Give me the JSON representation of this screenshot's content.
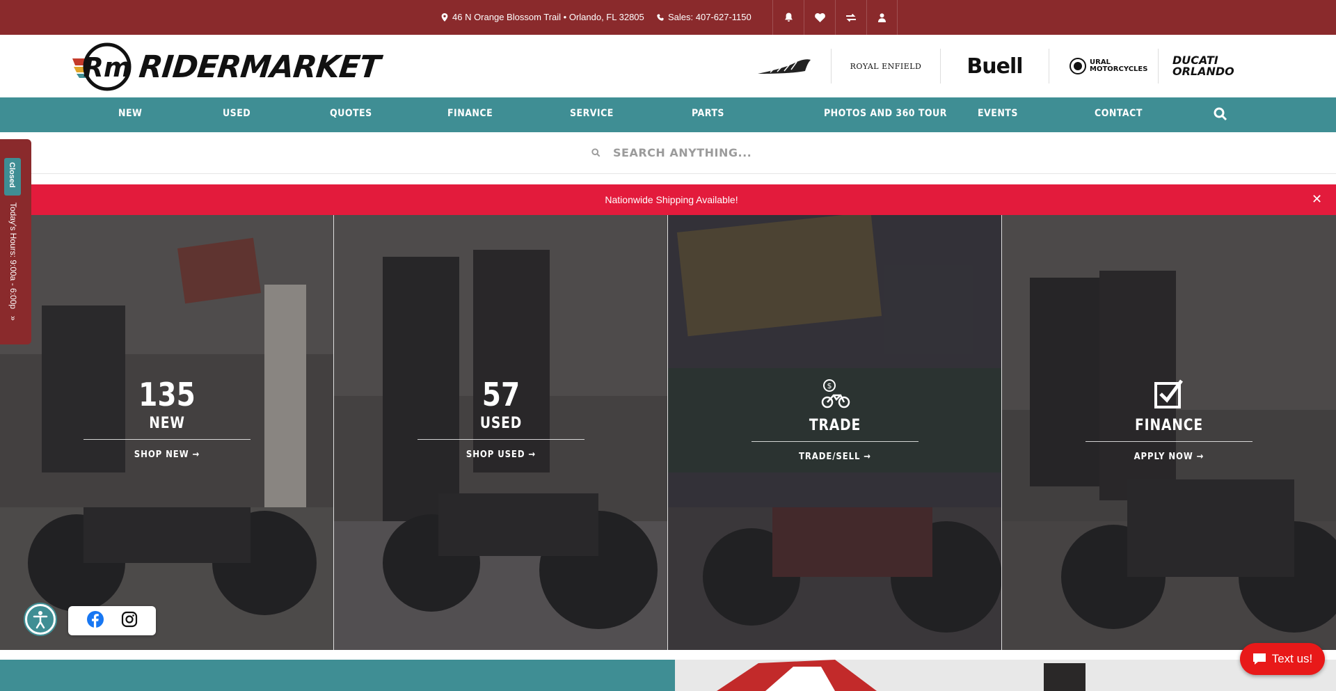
{
  "topbar": {
    "address": "46 N Orange Blossom Trail • Orlando, FL 32805",
    "phone": "Sales: 407-627-1150",
    "icons": [
      "bell-icon",
      "heart-icon",
      "compare-icon",
      "user-icon"
    ]
  },
  "header": {
    "logo_text": "RIDERMARKET",
    "logo_mark": "Rm",
    "brands": [
      "Indian",
      "ROYAL ENFIELD",
      "Buell",
      "URAL MOTORCYCLES",
      "DUCATI ORLANDO"
    ]
  },
  "nav": {
    "items": [
      "NEW",
      "USED",
      "QUOTES",
      "FINANCE",
      "SERVICE",
      "PARTS",
      "PHOTOS AND 360 TOUR",
      "EVENTS",
      "CONTACT"
    ]
  },
  "search": {
    "placeholder": "SEARCH ANYTHING..."
  },
  "banner": {
    "text": "Nationwide Shipping Available!",
    "close": "✕"
  },
  "hours_tab": {
    "status": "Closed",
    "hours": "Today's Hours: 9:00a - 6:00p",
    "toggle": "»"
  },
  "panels": [
    {
      "count": "135",
      "label": "NEW",
      "cta": "SHOP NEW →"
    },
    {
      "count": "57",
      "label": "USED",
      "cta": "SHOP USED →"
    },
    {
      "icon": "trade-motorcycle-icon",
      "label": "TRADE",
      "cta": "TRADE/SELL →"
    },
    {
      "icon": "checkbox-icon",
      "label": "FINANCE",
      "cta": "APPLY NOW →"
    }
  ],
  "chat": {
    "label": "Text us!"
  },
  "colors": {
    "topbar": "#8a2a2c",
    "nav": "#3f8e94",
    "banner": "#e31b3c",
    "chat": "#e81919"
  }
}
